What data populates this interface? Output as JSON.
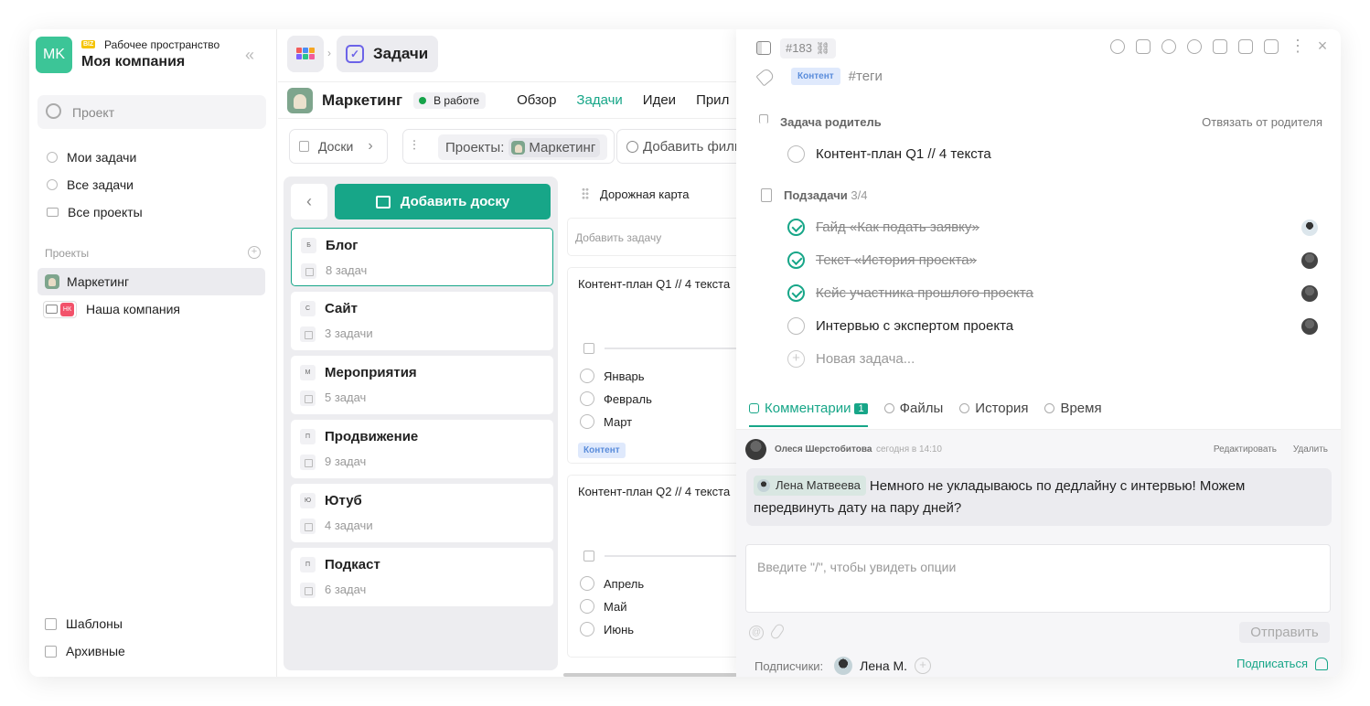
{
  "workspace": {
    "avatar": "MK",
    "badge": "BIZ",
    "subtitle": "Рабочее пространство",
    "name": "Моя компания"
  },
  "sidebar": {
    "search_placeholder": "Проект",
    "nav": [
      {
        "label": "Мои задачи"
      },
      {
        "label": "Все задачи"
      },
      {
        "label": "Все проекты"
      }
    ],
    "projects_label": "Проекты",
    "projects": [
      {
        "label": "Маркетинг"
      },
      {
        "label": "Наша компания",
        "badge": "НК"
      }
    ],
    "footer": [
      {
        "label": "Шаблоны"
      },
      {
        "label": "Архивные"
      }
    ]
  },
  "topbar": {
    "section": "Задачи"
  },
  "project": {
    "title": "Маркетинг",
    "status": "В работе",
    "tabs": [
      {
        "label": "Обзор"
      },
      {
        "label": "Задачи"
      },
      {
        "label": "Идеи"
      },
      {
        "label": "Прил"
      }
    ]
  },
  "toolbar": {
    "boards": "Доски",
    "projects_label": "Проекты:",
    "project_chip": "Маркетинг",
    "add_filter": "Добавить филь"
  },
  "boards": {
    "add_label": "Добавить доску",
    "items": [
      {
        "letter": "Б",
        "name": "Блог",
        "count": "8 задач"
      },
      {
        "letter": "С",
        "name": "Сайт",
        "count": "3 задачи"
      },
      {
        "letter": "М",
        "name": "Мероприятия",
        "count": "5 задач"
      },
      {
        "letter": "П",
        "name": "Продвижение",
        "count": "9 задач"
      },
      {
        "letter": "Ю",
        "name": "Ютуб",
        "count": "4 задачи"
      },
      {
        "letter": "П",
        "name": "Подкаст",
        "count": "6 задач"
      }
    ]
  },
  "column": {
    "title": "Дорожная карта",
    "add_placeholder": "Добавить задачу",
    "cards": [
      {
        "title": "Контент-план Q1 // 4 текста",
        "items": [
          "Январь",
          "Февраль",
          "Март"
        ],
        "tag": "Контент"
      },
      {
        "title": "Контент-план Q2 // 4 текста",
        "items": [
          "Апрель",
          "Май",
          "Июнь"
        ]
      }
    ]
  },
  "panel": {
    "task_id": "#183",
    "tag": "Контент",
    "tag_placeholder": "#теги",
    "parent_label": "Задача родитель",
    "unlink": "Отвязать от родителя",
    "parent_task": "Контент-план Q1 // 4 текста",
    "subtasks_label": "Подзадачи",
    "subtasks_count": "3/4",
    "subtasks": [
      {
        "title": "Гайд «Как подать заявку»",
        "done": true
      },
      {
        "title": "Текст «История проекта»",
        "done": true
      },
      {
        "title": "Кейс участника прошлого проекта",
        "done": true
      },
      {
        "title": "Интервью с экспертом проекта",
        "done": false
      }
    ],
    "new_task": "Новая задача...",
    "tabs": [
      {
        "label": "Комментарии",
        "badge": "1"
      },
      {
        "label": "Файлы"
      },
      {
        "label": "История"
      },
      {
        "label": "Время"
      }
    ],
    "comment": {
      "author": "Олеся Шерстобитова",
      "time": "сегодня в 14:10",
      "edit": "Редактировать",
      "delete": "Удалить",
      "mention": "Лена Матвеева",
      "text": "Немного не укладываюсь по дедлайну с интервью! Можем передвинуть дату на пару дней?"
    },
    "input_placeholder": "Введите \"/\", чтобы увидеть опции",
    "send": "Отправить",
    "subscribers_label": "Подписчики:",
    "subscriber": "Лена М.",
    "subscribe": "Подписаться"
  },
  "colors": {
    "accent": "#17a688",
    "workspace": "#3cc597",
    "tag_bg": "#dfe9fc",
    "tag_fg": "#5b8ddb"
  }
}
